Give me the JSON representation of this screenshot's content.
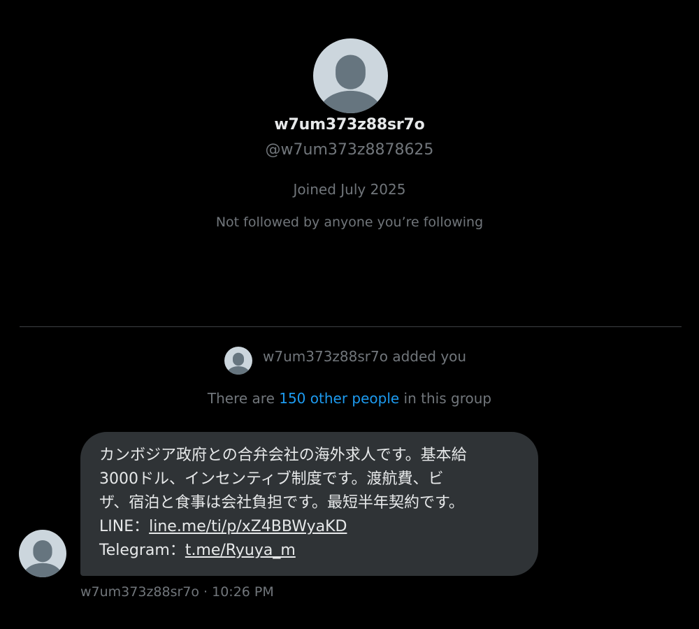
{
  "profile": {
    "display_name": "w7um373z88sr7o",
    "handle": "@w7um373z8878625",
    "joined": "Joined July 2025",
    "followed_status": "Not followed by anyone you’re following",
    "avatar_icon": "default-profile-avatar-icon"
  },
  "group_event": {
    "added_text": "w7um373z88sr7o added you",
    "group_prefix": "There are ",
    "group_link": "150 other people",
    "group_suffix": " in this group"
  },
  "message": {
    "lines": [
      "カンボジア政府との合弁会社の海外求人です。基本給",
      "3000ドル、インセンティブ制度です。渡航費、ビ",
      "ザ、宿泊と食事は会社負担です。最短半年契約です。"
    ],
    "line_label": "LINE：",
    "line_link": "line.me/ti/p/xZ4BBWyaKD",
    "telegram_label": "Telegram：",
    "telegram_link": "t.me/Ryuya_m",
    "sender_time": "w7um373z88sr7o · 10:26 PM"
  },
  "colors": {
    "background": "#000000",
    "bubble": "#2f3336",
    "secondary_text": "#71767b",
    "accent_link": "#1d9bf0",
    "avatar_bg": "#ccd6dd",
    "avatar_fg": "#66757f"
  }
}
